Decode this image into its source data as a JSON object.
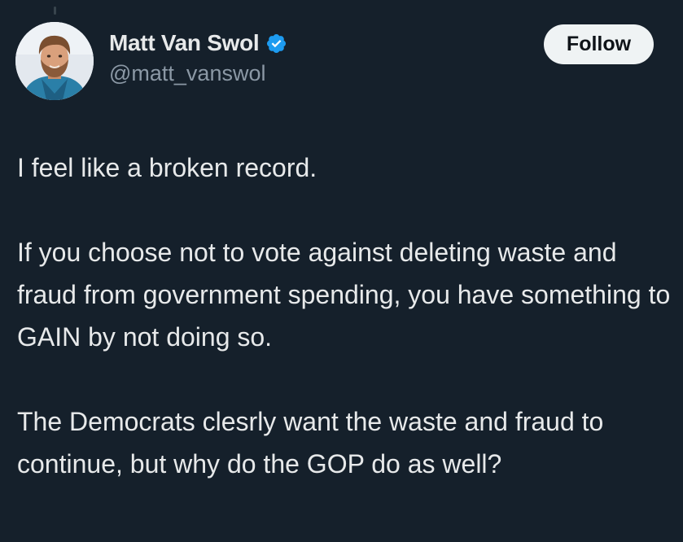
{
  "colors": {
    "background": "#15202b",
    "text_primary": "#e7e9ea",
    "text_secondary": "#8b98a5",
    "verified_badge": "#1d9bf0",
    "follow_button_bg": "#eff3f4",
    "follow_button_text": "#0f1419"
  },
  "author": {
    "display_name": "Matt Van Swol",
    "handle": "@matt_vanswol",
    "avatar_icon": "profile-photo",
    "verified_icon": "verified-badge-icon"
  },
  "actions": {
    "follow_label": "Follow"
  },
  "tweet": {
    "paragraphs": [
      "I feel like a broken record.",
      "If you choose not to vote against deleting waste and fraud from government spending, you have something to GAIN by not doing so.",
      "The Democrats clesrly want the waste and fraud to continue, but why do the GOP do as well?"
    ]
  }
}
